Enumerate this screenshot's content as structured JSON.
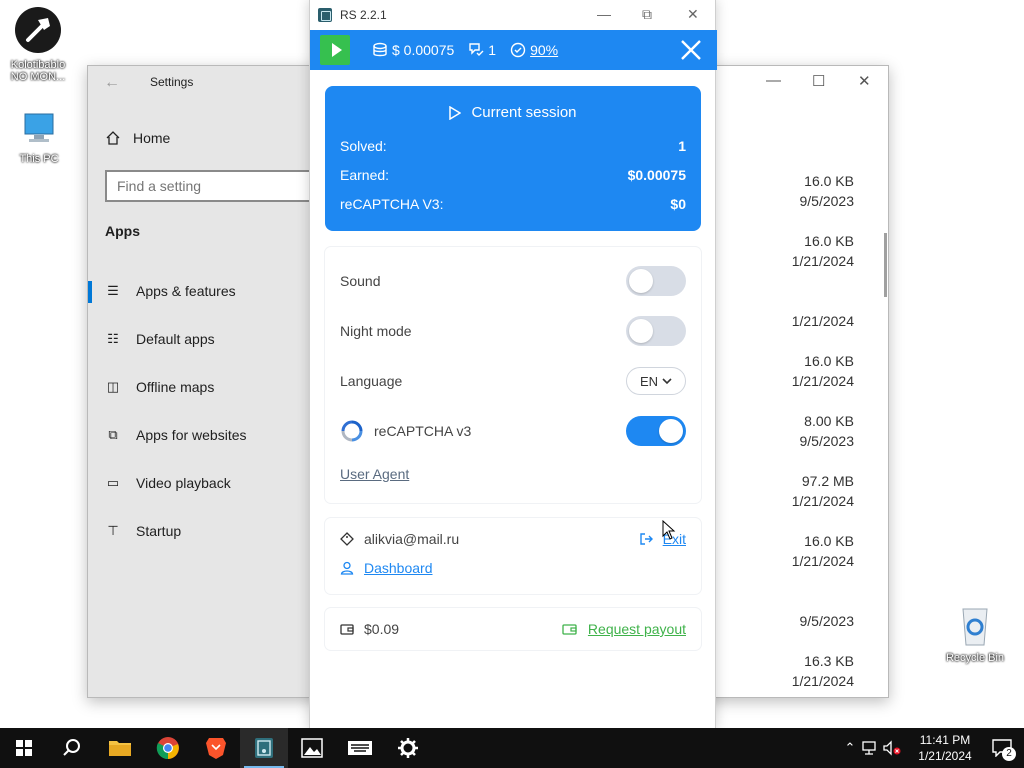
{
  "desktop": {
    "icons": [
      {
        "label": "Kolotibablo NO MON..."
      },
      {
        "label": "This PC"
      },
      {
        "label": "Recycle Bin"
      }
    ]
  },
  "settings_window": {
    "title": "Settings",
    "home_label": "Home",
    "search_placeholder": "Find a setting",
    "section": "Apps",
    "menu": [
      {
        "label": "Apps & features",
        "icon": "list-icon",
        "active": true
      },
      {
        "label": "Default apps",
        "icon": "default-apps-icon",
        "active": false
      },
      {
        "label": "Offline maps",
        "icon": "map-icon",
        "active": false
      },
      {
        "label": "Apps for websites",
        "icon": "web-app-icon",
        "active": false
      },
      {
        "label": "Video playback",
        "icon": "video-icon",
        "active": false
      },
      {
        "label": "Startup",
        "icon": "startup-icon",
        "active": false
      }
    ],
    "files": [
      {
        "size": "16.0 KB",
        "date": "9/5/2023"
      },
      {
        "size": "16.0 KB",
        "date": "1/21/2024"
      },
      {
        "size": "",
        "date": "1/21/2024"
      },
      {
        "size": "16.0 KB",
        "date": "1/21/2024"
      },
      {
        "size": "8.00 KB",
        "date": "9/5/2023"
      },
      {
        "size": "97.2 MB",
        "date": "1/21/2024"
      },
      {
        "size": "16.0 KB",
        "date": "1/21/2024"
      },
      {
        "size": "",
        "date": "9/5/2023"
      },
      {
        "size": "16.3 KB",
        "date": "1/21/2024"
      }
    ]
  },
  "rs_app": {
    "title": "RS 2.2.1",
    "topbar": {
      "balance": "$ 0.00075",
      "solved_count": "1",
      "accuracy": "90%"
    },
    "session": {
      "heading": "Current session",
      "rows": [
        {
          "label": "Solved:",
          "value": "1"
        },
        {
          "label": "Earned:",
          "value": "$0.00075"
        },
        {
          "label": "reCAPTCHA V3:",
          "value": "$0"
        }
      ]
    },
    "settings": {
      "sound_label": "Sound",
      "sound_on": false,
      "night_label": "Night mode",
      "night_on": false,
      "language_label": "Language",
      "language_value": "EN",
      "recaptcha_label": "reCAPTCHA v3",
      "recaptcha_on": true,
      "user_agent_label": "User Agent"
    },
    "account": {
      "email": "alikvia@mail.ru",
      "exit_label": "Exit",
      "dashboard_label": "Dashboard"
    },
    "wallet": {
      "balance": "$0.09",
      "payout_label": "Request payout"
    }
  },
  "taskbar": {
    "time": "11:41 PM",
    "date": "1/21/2024",
    "notification_count": "2"
  },
  "colors": {
    "accent_blue": "#1e88f2",
    "green": "#36c04f",
    "taskbar": "#101010"
  }
}
